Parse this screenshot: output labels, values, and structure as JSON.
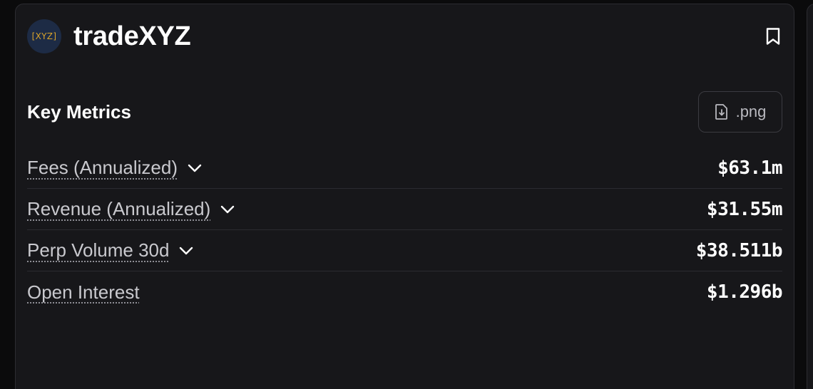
{
  "header": {
    "logo_text": "[XYZ]",
    "title": "tradeXYZ"
  },
  "section": {
    "title": "Key Metrics",
    "export_label": ".png"
  },
  "metrics": [
    {
      "label": "Fees (Annualized)",
      "value": "$63.1m",
      "has_dropdown": true
    },
    {
      "label": "Revenue (Annualized)",
      "value": "$31.55m",
      "has_dropdown": true
    },
    {
      "label": "Perp Volume 30d",
      "value": "$38.511b",
      "has_dropdown": true
    },
    {
      "label": "Open Interest",
      "value": "$1.296b",
      "has_dropdown": false
    }
  ],
  "colors": {
    "background": "#0b0b0c",
    "card": "#17171a",
    "logo_bg": "#1d2b45",
    "logo_text": "#d9a32a",
    "text_primary": "#ffffff",
    "text_secondary": "#c9c9ce"
  },
  "icons": {
    "bookmark": "bookmark-icon",
    "export": "file-download-icon",
    "dropdown": "chevron-down-icon"
  }
}
